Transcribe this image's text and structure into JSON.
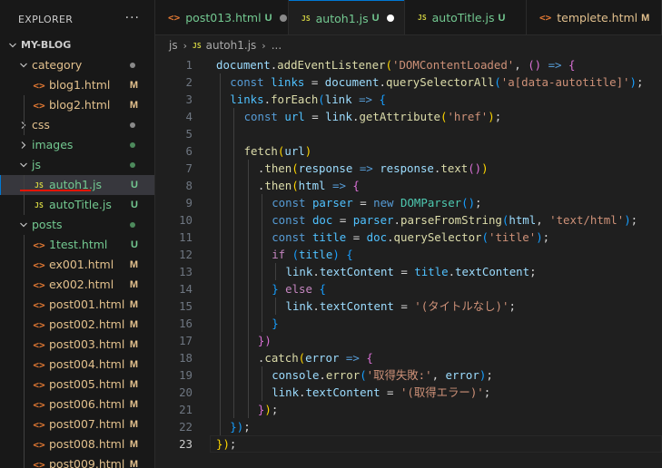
{
  "explorer": {
    "title": "EXPLORER",
    "more_icon": "ellipsis-icon",
    "tree": [
      {
        "label": "MY-BLOG",
        "type": "root-folder",
        "expanded": true
      },
      {
        "label": "category",
        "type": "folder",
        "expanded": true,
        "status_dot": "#8a8a8a"
      },
      {
        "label": "blog1.html",
        "type": "html",
        "badge": "M"
      },
      {
        "label": "blog2.html",
        "type": "html",
        "badge": "M"
      },
      {
        "label": "css",
        "type": "folder",
        "expanded": false,
        "status_dot": "#8a8a8a"
      },
      {
        "label": "images",
        "type": "folder",
        "expanded": false,
        "status_dot": "#4d8a5c"
      },
      {
        "label": "js",
        "type": "folder",
        "expanded": true,
        "status_dot": "#4d8a5c"
      },
      {
        "label": "autoh1.js",
        "type": "js",
        "badge": "U",
        "selected": true
      },
      {
        "label": "autoTitle.js",
        "type": "js",
        "badge": "U"
      },
      {
        "label": "posts",
        "type": "folder",
        "expanded": true,
        "status_dot": "#4d8a5c"
      },
      {
        "label": "1test.html",
        "type": "html",
        "badge": "U"
      },
      {
        "label": "ex001.html",
        "type": "html",
        "badge": "M"
      },
      {
        "label": "ex002.html",
        "type": "html",
        "badge": "M"
      },
      {
        "label": "post001.html",
        "type": "html",
        "badge": "M"
      },
      {
        "label": "post002.html",
        "type": "html",
        "badge": "M"
      },
      {
        "label": "post003.html",
        "type": "html",
        "badge": "M"
      },
      {
        "label": "post004.html",
        "type": "html",
        "badge": "M"
      },
      {
        "label": "post005.html",
        "type": "html",
        "badge": "M"
      },
      {
        "label": "post006.html",
        "type": "html",
        "badge": "M"
      },
      {
        "label": "post007.html",
        "type": "html",
        "badge": "M"
      },
      {
        "label": "post008.html",
        "type": "html",
        "badge": "M"
      },
      {
        "label": "post009.html",
        "type": "html",
        "badge": "M"
      }
    ]
  },
  "tabs": [
    {
      "label": "post013.html",
      "icon_text": "<>",
      "icon_name": "html-file-icon",
      "badge": "U",
      "status": "untracked",
      "dot": "#8a8a8a"
    },
    {
      "label": "autoh1.js",
      "icon_text": "JS",
      "icon_name": "js-file-icon",
      "badge": "U",
      "status": "untracked",
      "active": true,
      "dot": "#ffffff"
    },
    {
      "label": "autoTitle.js",
      "icon_text": "JS",
      "icon_name": "js-file-icon",
      "badge": "U",
      "status": "untracked"
    },
    {
      "label": "templete.html",
      "icon_text": "<>",
      "icon_name": "html-file-icon",
      "badge": "M",
      "status": "modified"
    }
  ],
  "breadcrumb": {
    "folder": "js",
    "file_icon": "JS",
    "file": "autoh1.js",
    "more": "..."
  },
  "editor": {
    "current_line": 23,
    "lines": [
      {
        "n": "1",
        "indent": 0,
        "tokens": [
          [
            "document",
            "var"
          ],
          [
            ".",
            "pl"
          ],
          [
            "addEventListener",
            "fn"
          ],
          [
            "(",
            "b1"
          ],
          [
            "'DOMContentLoaded'",
            "str"
          ],
          [
            ", ",
            "pl"
          ],
          [
            "()",
            "b2"
          ],
          [
            " ",
            "pl"
          ],
          [
            "=>",
            "kw"
          ],
          [
            " ",
            "pl"
          ],
          [
            "{",
            "b2"
          ]
        ]
      },
      {
        "n": "2",
        "indent": 1,
        "tokens": [
          [
            "const",
            "kw"
          ],
          [
            " ",
            "pl"
          ],
          [
            "links",
            "cst"
          ],
          [
            " = ",
            "pl"
          ],
          [
            "document",
            "var"
          ],
          [
            ".",
            "pl"
          ],
          [
            "querySelectorAll",
            "fn"
          ],
          [
            "(",
            "b3"
          ],
          [
            "'a[data-autotitle]'",
            "str"
          ],
          [
            ")",
            "b3"
          ],
          [
            ";",
            "pl"
          ]
        ]
      },
      {
        "n": "3",
        "indent": 1,
        "tokens": [
          [
            "links",
            "cst"
          ],
          [
            ".",
            "pl"
          ],
          [
            "forEach",
            "fn"
          ],
          [
            "(",
            "b3"
          ],
          [
            "link",
            "var"
          ],
          [
            " ",
            "pl"
          ],
          [
            "=>",
            "kw"
          ],
          [
            " ",
            "pl"
          ],
          [
            "{",
            "b3"
          ]
        ]
      },
      {
        "n": "4",
        "indent": 2,
        "tokens": [
          [
            "const",
            "kw"
          ],
          [
            " ",
            "pl"
          ],
          [
            "url",
            "cst"
          ],
          [
            " = ",
            "pl"
          ],
          [
            "link",
            "var"
          ],
          [
            ".",
            "pl"
          ],
          [
            "getAttribute",
            "fn"
          ],
          [
            "(",
            "b1"
          ],
          [
            "'href'",
            "str"
          ],
          [
            ")",
            "b1"
          ],
          [
            ";",
            "pl"
          ]
        ]
      },
      {
        "n": "5",
        "indent": 0,
        "tokens": []
      },
      {
        "n": "6",
        "indent": 2,
        "tokens": [
          [
            "fetch",
            "fn"
          ],
          [
            "(",
            "b1"
          ],
          [
            "url",
            "var"
          ],
          [
            ")",
            "b1"
          ]
        ]
      },
      {
        "n": "7",
        "indent": 3,
        "tokens": [
          [
            ".",
            "pl"
          ],
          [
            "then",
            "fn"
          ],
          [
            "(",
            "b1"
          ],
          [
            "response",
            "var"
          ],
          [
            " ",
            "pl"
          ],
          [
            "=>",
            "kw"
          ],
          [
            " ",
            "pl"
          ],
          [
            "response",
            "var"
          ],
          [
            ".",
            "pl"
          ],
          [
            "text",
            "fn"
          ],
          [
            "()",
            "b2"
          ],
          [
            ")",
            "b1"
          ]
        ]
      },
      {
        "n": "8",
        "indent": 3,
        "tokens": [
          [
            ".",
            "pl"
          ],
          [
            "then",
            "fn"
          ],
          [
            "(",
            "b1"
          ],
          [
            "html",
            "var"
          ],
          [
            " ",
            "pl"
          ],
          [
            "=>",
            "kw"
          ],
          [
            " ",
            "pl"
          ],
          [
            "{",
            "b2"
          ]
        ]
      },
      {
        "n": "9",
        "indent": 4,
        "tokens": [
          [
            "const",
            "kw"
          ],
          [
            " ",
            "pl"
          ],
          [
            "parser",
            "cst"
          ],
          [
            " = ",
            "pl"
          ],
          [
            "new",
            "kw"
          ],
          [
            " ",
            "pl"
          ],
          [
            "DOMParser",
            "cls"
          ],
          [
            "()",
            "b3"
          ],
          [
            ";",
            "pl"
          ]
        ]
      },
      {
        "n": "10",
        "indent": 4,
        "tokens": [
          [
            "const",
            "kw"
          ],
          [
            " ",
            "pl"
          ],
          [
            "doc",
            "cst"
          ],
          [
            " = ",
            "pl"
          ],
          [
            "parser",
            "cst"
          ],
          [
            ".",
            "pl"
          ],
          [
            "parseFromString",
            "fn"
          ],
          [
            "(",
            "b3"
          ],
          [
            "html",
            "var"
          ],
          [
            ", ",
            "pl"
          ],
          [
            "'text/html'",
            "str"
          ],
          [
            ")",
            "b3"
          ],
          [
            ";",
            "pl"
          ]
        ]
      },
      {
        "n": "11",
        "indent": 4,
        "tokens": [
          [
            "const",
            "kw"
          ],
          [
            " ",
            "pl"
          ],
          [
            "title",
            "cst"
          ],
          [
            " = ",
            "pl"
          ],
          [
            "doc",
            "cst"
          ],
          [
            ".",
            "pl"
          ],
          [
            "querySelector",
            "fn"
          ],
          [
            "(",
            "b3"
          ],
          [
            "'title'",
            "str"
          ],
          [
            ")",
            "b3"
          ],
          [
            ";",
            "pl"
          ]
        ]
      },
      {
        "n": "12",
        "indent": 4,
        "tokens": [
          [
            "if",
            "ctl"
          ],
          [
            " ",
            "pl"
          ],
          [
            "(",
            "b3"
          ],
          [
            "title",
            "cst"
          ],
          [
            ")",
            "b3"
          ],
          [
            " ",
            "pl"
          ],
          [
            "{",
            "b3"
          ]
        ]
      },
      {
        "n": "13",
        "indent": 5,
        "tokens": [
          [
            "link",
            "var"
          ],
          [
            ".",
            "pl"
          ],
          [
            "textContent",
            "var"
          ],
          [
            " = ",
            "pl"
          ],
          [
            "title",
            "cst"
          ],
          [
            ".",
            "pl"
          ],
          [
            "textContent",
            "var"
          ],
          [
            ";",
            "pl"
          ]
        ]
      },
      {
        "n": "14",
        "indent": 4,
        "tokens": [
          [
            "}",
            "b3"
          ],
          [
            " ",
            "pl"
          ],
          [
            "else",
            "ctl"
          ],
          [
            " ",
            "pl"
          ],
          [
            "{",
            "b3"
          ]
        ]
      },
      {
        "n": "15",
        "indent": 5,
        "tokens": [
          [
            "link",
            "var"
          ],
          [
            ".",
            "pl"
          ],
          [
            "textContent",
            "var"
          ],
          [
            " = ",
            "pl"
          ],
          [
            "'(タイトルなし)'",
            "str"
          ],
          [
            ";",
            "pl"
          ]
        ]
      },
      {
        "n": "16",
        "indent": 4,
        "tokens": [
          [
            "}",
            "b3"
          ]
        ]
      },
      {
        "n": "17",
        "indent": 3,
        "tokens": [
          [
            "})",
            "b2"
          ]
        ]
      },
      {
        "n": "18",
        "indent": 3,
        "tokens": [
          [
            ".",
            "pl"
          ],
          [
            "catch",
            "fn"
          ],
          [
            "(",
            "b1"
          ],
          [
            "error",
            "var"
          ],
          [
            " ",
            "pl"
          ],
          [
            "=>",
            "kw"
          ],
          [
            " ",
            "pl"
          ],
          [
            "{",
            "b2"
          ]
        ]
      },
      {
        "n": "19",
        "indent": 4,
        "tokens": [
          [
            "console",
            "var"
          ],
          [
            ".",
            "pl"
          ],
          [
            "error",
            "fn"
          ],
          [
            "(",
            "b3"
          ],
          [
            "'取得失敗:'",
            "str"
          ],
          [
            ", ",
            "pl"
          ],
          [
            "error",
            "var"
          ],
          [
            ")",
            "b3"
          ],
          [
            ";",
            "pl"
          ]
        ]
      },
      {
        "n": "20",
        "indent": 4,
        "tokens": [
          [
            "link",
            "var"
          ],
          [
            ".",
            "pl"
          ],
          [
            "textContent",
            "var"
          ],
          [
            " = ",
            "pl"
          ],
          [
            "'(取得エラー)'",
            "str"
          ],
          [
            ";",
            "pl"
          ]
        ]
      },
      {
        "n": "21",
        "indent": 3,
        "tokens": [
          [
            "}",
            "b2"
          ],
          [
            ")",
            "b1"
          ],
          [
            ";",
            "pl"
          ]
        ]
      },
      {
        "n": "22",
        "indent": 1,
        "tokens": [
          [
            "})",
            "b3"
          ],
          [
            ";",
            "pl"
          ]
        ]
      },
      {
        "n": "23",
        "indent": 0,
        "tokens": [
          [
            "})",
            "b1"
          ],
          [
            ";",
            "pl"
          ]
        ]
      }
    ]
  },
  "colors": {
    "modified": "#e2c08d",
    "untracked": "#73c991",
    "accent": "#0078d4",
    "underline": "#e51400"
  }
}
